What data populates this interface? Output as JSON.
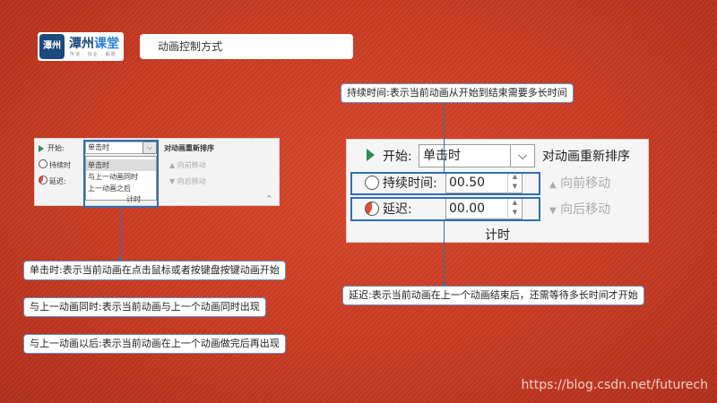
{
  "logo": {
    "seal": "潭州",
    "title_a": "潭州",
    "title_b": "课堂",
    "sub": "传道 · 授业 · 解惑"
  },
  "page_title": "动画控制方式",
  "ribbon_small": {
    "start_label": "开始:",
    "start_value": "单击时",
    "duration_label": "持续时",
    "delay_label": "延迟:",
    "dropdown_options": [
      "单击时",
      "与上一动画同时",
      "上一动画之后"
    ],
    "reorder_title": "对动画重新排序",
    "move_earlier": "向前移动",
    "move_later": "向后移动",
    "group": "计时",
    "collapse": "^"
  },
  "ribbon_large": {
    "start_label": "开始:",
    "start_value": "单击时",
    "duration_label": "持续时间:",
    "duration_value": "00.50",
    "delay_label": "延迟:",
    "delay_value": "00.00",
    "reorder_title": "对动画重新排序",
    "move_earlier": "向前移动",
    "move_later": "向后移动",
    "group": "计时"
  },
  "notes": {
    "duration": "持续时间:表示当前动画从开始到结束需要多长时间",
    "on_click": "单击时:表示当前动画在点击鼠标或者按键盘按键动画开始",
    "with_previous": "与上一动画同时:表示当前动画与上一个动画同时出现",
    "after_previous": "与上一动画以后:表示当前动画在上一个动画做完后再出现",
    "delay": "延迟:表示当前动画在上一个动画结束后，还需等待多长时间才开始"
  },
  "watermark": "https://blog.csdn.net/futurech",
  "colors": {
    "background": "#c93a22",
    "accent": "#2f6fb3",
    "play": "#2e8b57"
  }
}
